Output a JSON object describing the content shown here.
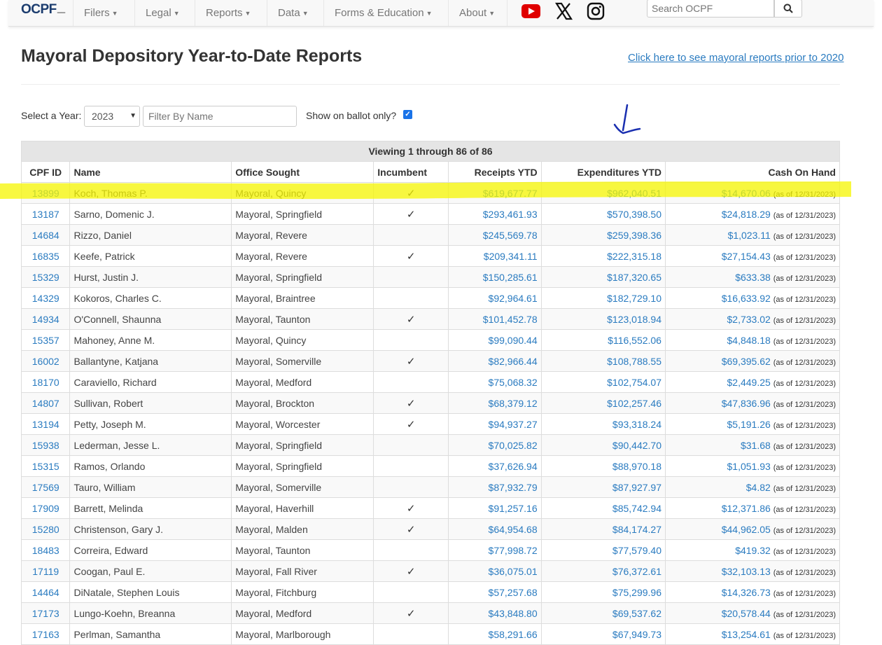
{
  "nav": {
    "logo": "OCPF",
    "items": [
      "Filers",
      "Legal",
      "Reports",
      "Data",
      "Forms & Education",
      "About"
    ],
    "search_placeholder": "Search OCPF"
  },
  "page": {
    "title": "Mayoral Depository Year-to-Date Reports",
    "prior_link": "Click here to see mayoral reports prior to 2020"
  },
  "filters": {
    "year_label": "Select a Year:",
    "year_value": "2023",
    "name_placeholder": "Filter By Name",
    "ballot_label": "Show on ballot only?",
    "ballot_checked": true
  },
  "table": {
    "viewing": "Viewing 1 through 86 of 86",
    "headers": [
      "CPF ID",
      "Name",
      "Office Sought",
      "Incumbent",
      "Receipts YTD",
      "Expenditures YTD",
      "Cash On Hand"
    ],
    "as_of": "(as of 12/31/2023)",
    "rows": [
      {
        "id": "13899",
        "name": "Koch, Thomas P.",
        "office": "Mayoral, Quincy",
        "inc": "✓",
        "receipts": "$619,677.77",
        "expend": "$962,040.51",
        "cash": "$14,670.06"
      },
      {
        "id": "13187",
        "name": "Sarno, Domenic J.",
        "office": "Mayoral, Springfield",
        "inc": "✓",
        "receipts": "$293,461.93",
        "expend": "$570,398.50",
        "cash": "$24,818.29"
      },
      {
        "id": "14684",
        "name": "Rizzo, Daniel",
        "office": "Mayoral, Revere",
        "inc": "",
        "receipts": "$245,569.78",
        "expend": "$259,398.36",
        "cash": "$1,023.11"
      },
      {
        "id": "16835",
        "name": "Keefe, Patrick",
        "office": "Mayoral, Revere",
        "inc": "✓",
        "receipts": "$209,341.11",
        "expend": "$222,315.18",
        "cash": "$27,154.43"
      },
      {
        "id": "15329",
        "name": "Hurst, Justin J.",
        "office": "Mayoral, Springfield",
        "inc": "",
        "receipts": "$150,285.61",
        "expend": "$187,320.65",
        "cash": "$633.38"
      },
      {
        "id": "14329",
        "name": "Kokoros, Charles C.",
        "office": "Mayoral, Braintree",
        "inc": "",
        "receipts": "$92,964.61",
        "expend": "$182,729.10",
        "cash": "$16,633.92"
      },
      {
        "id": "14934",
        "name": "O'Connell, Shaunna",
        "office": "Mayoral, Taunton",
        "inc": "✓",
        "receipts": "$101,452.78",
        "expend": "$123,018.94",
        "cash": "$2,733.02"
      },
      {
        "id": "15357",
        "name": "Mahoney, Anne M.",
        "office": "Mayoral, Quincy",
        "inc": "",
        "receipts": "$99,090.44",
        "expend": "$116,552.06",
        "cash": "$4,848.18"
      },
      {
        "id": "16002",
        "name": "Ballantyne, Katjana",
        "office": "Mayoral, Somerville",
        "inc": "✓",
        "receipts": "$82,966.44",
        "expend": "$108,788.55",
        "cash": "$69,395.62"
      },
      {
        "id": "18170",
        "name": "Caraviello, Richard",
        "office": "Mayoral, Medford",
        "inc": "",
        "receipts": "$75,068.32",
        "expend": "$102,754.07",
        "cash": "$2,449.25"
      },
      {
        "id": "14807",
        "name": "Sullivan, Robert",
        "office": "Mayoral, Brockton",
        "inc": "✓",
        "receipts": "$68,379.12",
        "expend": "$102,257.46",
        "cash": "$47,836.96"
      },
      {
        "id": "13194",
        "name": "Petty, Joseph M.",
        "office": "Mayoral, Worcester",
        "inc": "✓",
        "receipts": "$94,937.27",
        "expend": "$93,318.24",
        "cash": "$5,191.26"
      },
      {
        "id": "15938",
        "name": "Lederman, Jesse L.",
        "office": "Mayoral, Springfield",
        "inc": "",
        "receipts": "$70,025.82",
        "expend": "$90,442.70",
        "cash": "$31.68"
      },
      {
        "id": "15315",
        "name": "Ramos, Orlando",
        "office": "Mayoral, Springfield",
        "inc": "",
        "receipts": "$37,626.94",
        "expend": "$88,970.18",
        "cash": "$1,051.93"
      },
      {
        "id": "17569",
        "name": "Tauro, William",
        "office": "Mayoral, Somerville",
        "inc": "",
        "receipts": "$87,932.79",
        "expend": "$87,927.97",
        "cash": "$4.82"
      },
      {
        "id": "17909",
        "name": "Barrett, Melinda",
        "office": "Mayoral, Haverhill",
        "inc": "✓",
        "receipts": "$91,257.16",
        "expend": "$85,742.94",
        "cash": "$12,371.86"
      },
      {
        "id": "15280",
        "name": "Christenson, Gary J.",
        "office": "Mayoral, Malden",
        "inc": "✓",
        "receipts": "$64,954.68",
        "expend": "$84,174.27",
        "cash": "$44,962.05"
      },
      {
        "id": "18483",
        "name": "Correira, Edward",
        "office": "Mayoral, Taunton",
        "inc": "",
        "receipts": "$77,998.72",
        "expend": "$77,579.40",
        "cash": "$419.32"
      },
      {
        "id": "17119",
        "name": "Coogan, Paul E.",
        "office": "Mayoral, Fall River",
        "inc": "✓",
        "receipts": "$36,075.01",
        "expend": "$76,372.61",
        "cash": "$32,103.13"
      },
      {
        "id": "14464",
        "name": "DiNatale, Stephen Louis",
        "office": "Mayoral, Fitchburg",
        "inc": "",
        "receipts": "$57,257.68",
        "expend": "$75,299.96",
        "cash": "$14,326.73"
      },
      {
        "id": "17173",
        "name": "Lungo-Koehn, Breanna",
        "office": "Mayoral, Medford",
        "inc": "✓",
        "receipts": "$43,848.80",
        "expend": "$69,537.62",
        "cash": "$20,578.44"
      },
      {
        "id": "17163",
        "name": "Perlman, Samantha",
        "office": "Mayoral, Marlborough",
        "inc": "",
        "receipts": "$58,291.66",
        "expend": "$67,949.73",
        "cash": "$13,254.61"
      }
    ]
  },
  "colors": {
    "link": "#2a7bc0",
    "highlight": "#f5f500",
    "arrow": "#1a2fb0"
  }
}
